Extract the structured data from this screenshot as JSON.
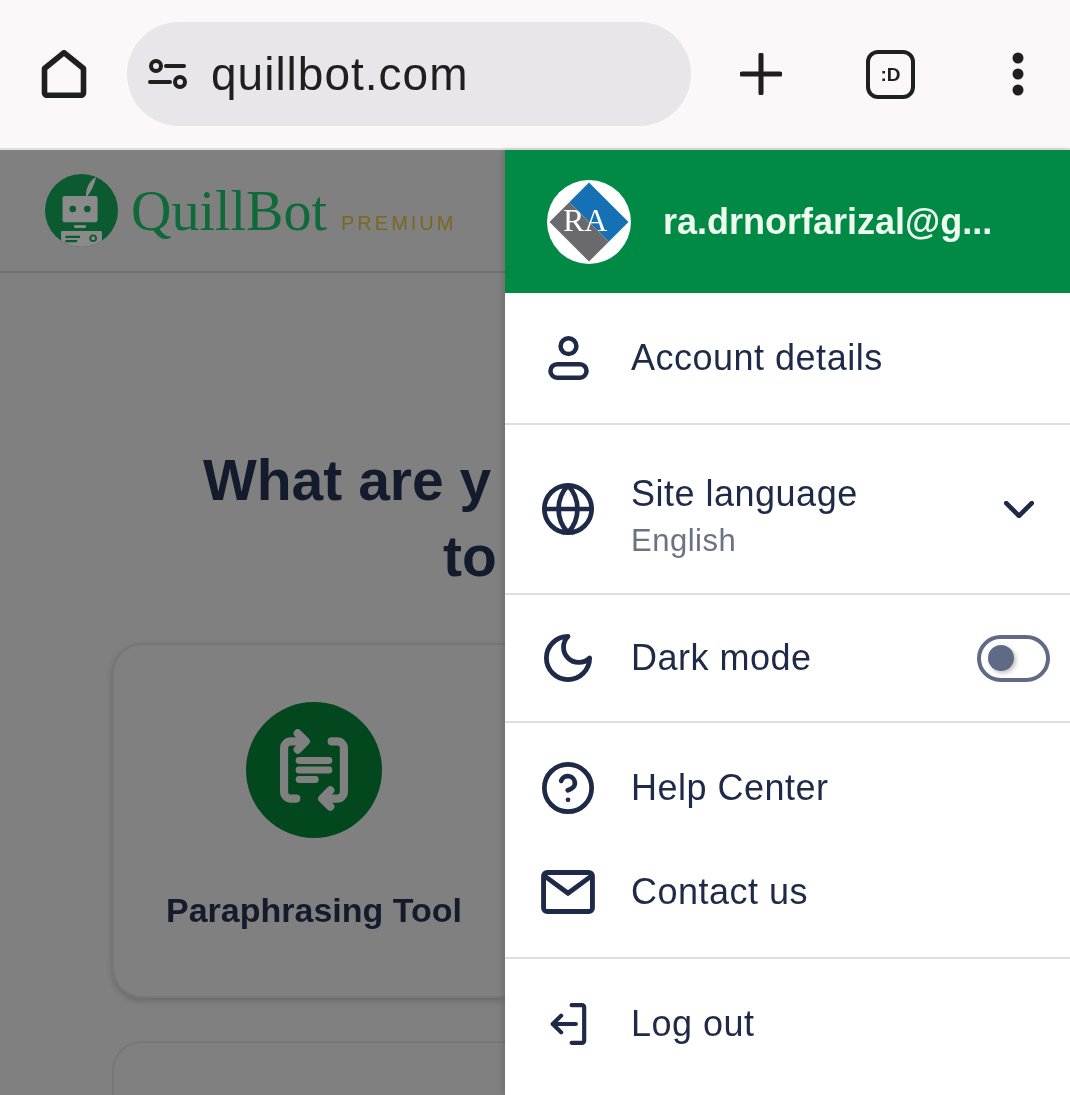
{
  "browser": {
    "url": "quillbot.com",
    "tab_switcher": ":D"
  },
  "page": {
    "logo": {
      "name": "QuillBot",
      "badge": "PREMIUM"
    },
    "heading_lines": [
      "What are y",
      "to"
    ],
    "tool_cards": [
      {
        "label": "Paraphrasing Tool"
      }
    ]
  },
  "account_menu": {
    "avatar_initials": "RA",
    "email": "ra.drnorfarizal@g...",
    "groups": [
      {
        "items": [
          {
            "kind": "link",
            "label": "Account details"
          }
        ]
      },
      {
        "items": [
          {
            "kind": "dropdown",
            "label": "Site language",
            "value": "English",
            "expanded": false
          }
        ]
      },
      {
        "items": [
          {
            "kind": "toggle",
            "label": "Dark mode",
            "on": false
          }
        ]
      },
      {
        "items": [
          {
            "kind": "link",
            "label": "Help Center"
          },
          {
            "kind": "link",
            "label": "Contact us"
          }
        ]
      },
      {
        "items": [
          {
            "kind": "link",
            "label": "Log out"
          }
        ]
      }
    ]
  }
}
